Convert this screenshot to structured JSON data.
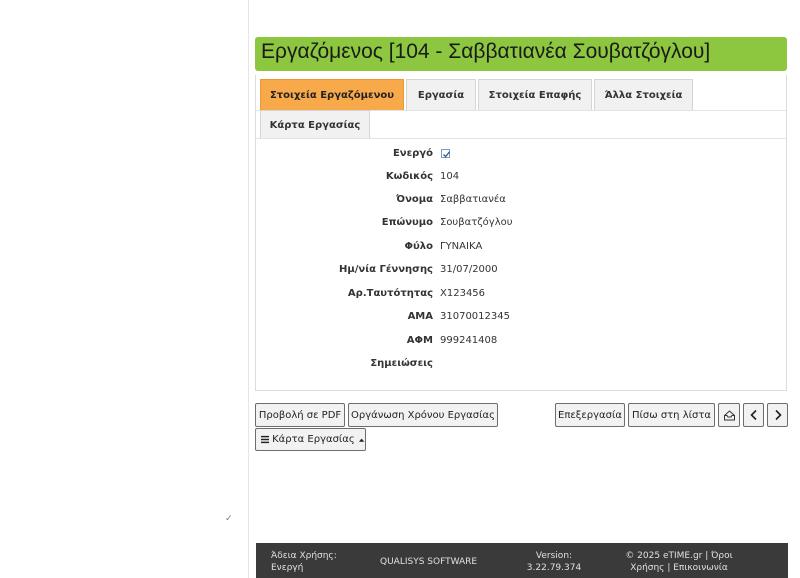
{
  "header": {
    "title": "Εργαζόμενος [104 - Σαββατιανέα Σουβατζόγλου]"
  },
  "tabs": [
    {
      "label": "Στοιχεία Εργαζόμενου",
      "active": true
    },
    {
      "label": "Εργασία",
      "active": false
    },
    {
      "label": "Στοιχεία Επαφής",
      "active": false
    },
    {
      "label": "Άλλα Στοιχεία",
      "active": false
    },
    {
      "label": "Κάρτα Εργασίας",
      "active": false
    }
  ],
  "form": {
    "active": {
      "label": "Ενεργό",
      "checked": true
    },
    "code": {
      "label": "Κωδικός",
      "value": "104"
    },
    "first_name": {
      "label": "Όνομα",
      "value": "Σαββατιανέα"
    },
    "last_name": {
      "label": "Επώνυμο",
      "value": "Σουβατζόγλου"
    },
    "gender": {
      "label": "Φύλο",
      "value": "ΓΥΝΑΙΚΑ"
    },
    "birth_date": {
      "label": "Ημ/νία Γέννησης",
      "value": "31/07/2000"
    },
    "id_number": {
      "label": "Αρ.Ταυτότητας",
      "value": "Χ123456"
    },
    "ama": {
      "label": "ΑΜΑ",
      "value": "31070012345"
    },
    "afm": {
      "label": "ΑΦΜ",
      "value": "999241408"
    },
    "notes": {
      "label": "Σημειώσεις",
      "value": ""
    }
  },
  "actions": {
    "pdf_label": "Προβολή σε PDF",
    "schedule_label": "Οργάνωση Χρόνου Εργασίας",
    "edit_label": "Επεξεργασία",
    "back_label": "Πίσω στη λίστα",
    "workcard_menu_label": "Κάρτα Εργασίας"
  },
  "icons": {
    "inbox": "inbox-icon",
    "prev": "chevron-left-icon",
    "next": "chevron-right-icon",
    "menu": "hamburger-icon",
    "caret": "caret-up-icon"
  },
  "footer": {
    "license_line1": "Άδεια Χρήσης:",
    "license_line2": "Ενεργή",
    "company": "QUALISYS SOFTWARE",
    "version_line1": "Version:",
    "version_line2": "3.22.79.374",
    "copyright_line1": "© 2025 eTIME.gr | Όροι",
    "copyright_line2": "Χρήσης | Επικοινωνία"
  },
  "misc": {
    "stray_mark": "✓"
  },
  "colors": {
    "title_bg": "#8dc63f",
    "active_tab": "#f8a94a",
    "footer_bg": "#3a3a3a"
  }
}
